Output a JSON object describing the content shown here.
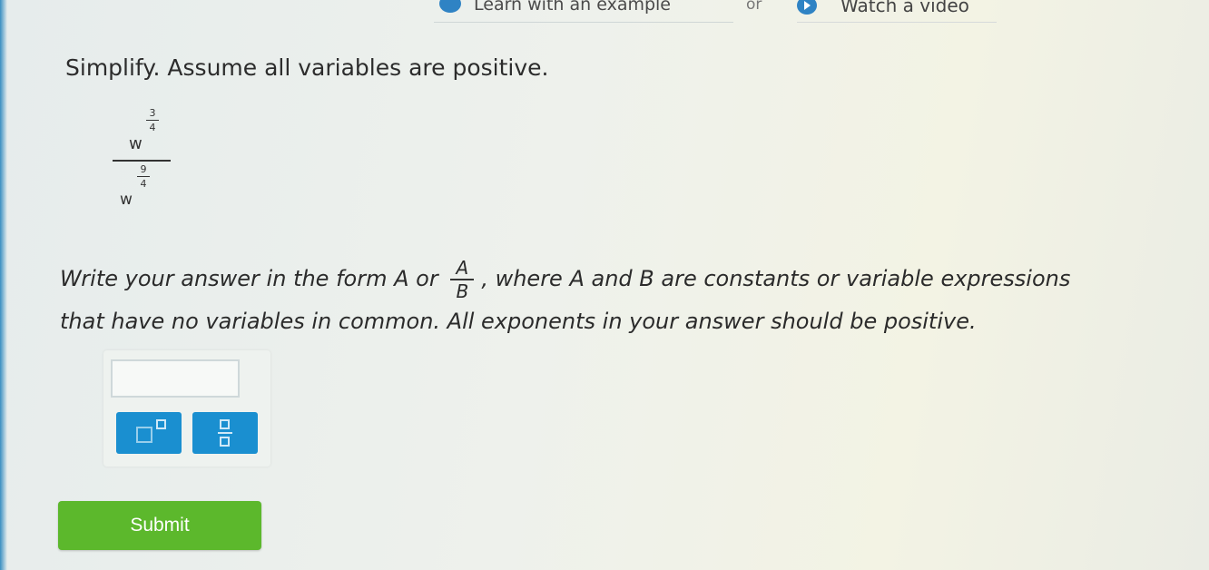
{
  "top_links": {
    "learn_label": "Learn with an example",
    "or_text": "or",
    "video_label": "Watch a video"
  },
  "question": {
    "instruction": "Simplify. Assume all variables are positive.",
    "expression": {
      "numerator_base": "w",
      "numerator_exp_num": "3",
      "numerator_exp_den": "4",
      "denominator_base": "w",
      "denominator_exp_num": "9",
      "denominator_exp_den": "4"
    },
    "prompt_part1": "Write your answer in the form A or",
    "prompt_fraction_top": "A",
    "prompt_fraction_bottom": "B",
    "prompt_part2": ", where A and B are constants or variable expressions",
    "prompt_line2": "that have no variables in common. All exponents in your answer should be positive."
  },
  "answer": {
    "value": "",
    "tools": [
      "exponent-tool",
      "fraction-tool"
    ]
  },
  "submit_label": "Submit",
  "colors": {
    "accent": "#1a8fd0",
    "submit": "#5cb82c"
  }
}
